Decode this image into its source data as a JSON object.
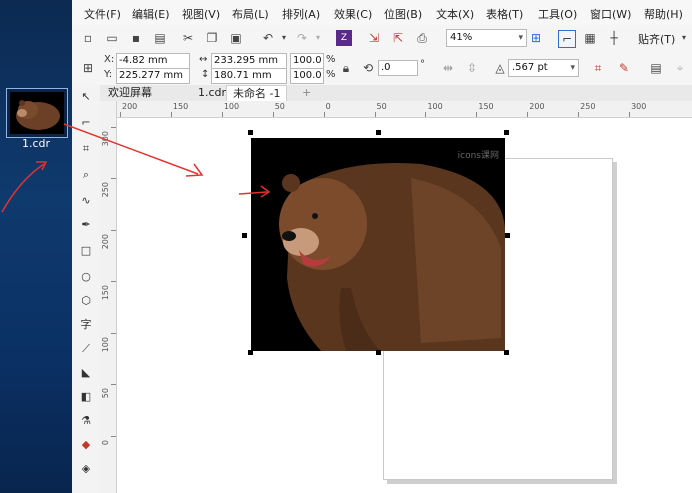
{
  "desktop": {
    "file_label": "1.cdr",
    "arrow_color": "#e0332e"
  },
  "menubar": {
    "items": [
      "文件(F)",
      "编辑(E)",
      "视图(V)",
      "布局(L)",
      "排列(A)",
      "效果(C)",
      "位图(B)",
      "文本(X)",
      "表格(T)",
      "工具(O)",
      "窗口(W)",
      "帮助(H)"
    ]
  },
  "toolbar": {
    "zoom_value": "41%",
    "snap_label": "贴齐(T)"
  },
  "propertybar": {
    "x_label": "X:",
    "x_value": "-4.82 mm",
    "y_label": "Y:",
    "y_value": "225.277 mm",
    "width_value": "233.295 mm",
    "height_value": "180.71 mm",
    "scale_w": "100.0",
    "scale_h": "100.0",
    "percent": "%",
    "rotation_value": ".0",
    "degree": "°",
    "outline_value": ".567 pt"
  },
  "tabs": [
    {
      "label": "欢迎屏幕"
    },
    {
      "label": "1.cdr"
    },
    {
      "label": "未命名 -1"
    }
  ],
  "ruler": {
    "h_ticks": [
      "200",
      "150",
      "100",
      "50",
      "0",
      "50",
      "100",
      "150",
      "200",
      "250",
      "300"
    ],
    "v_ticks": [
      "300",
      "250",
      "200",
      "150",
      "100",
      "50",
      "0"
    ]
  },
  "canvas": {
    "watermark": "icons课网"
  },
  "colors": {
    "accent": "#2a6fd6",
    "arrow": "#e0332e",
    "desktop": "#0f3a6e"
  }
}
